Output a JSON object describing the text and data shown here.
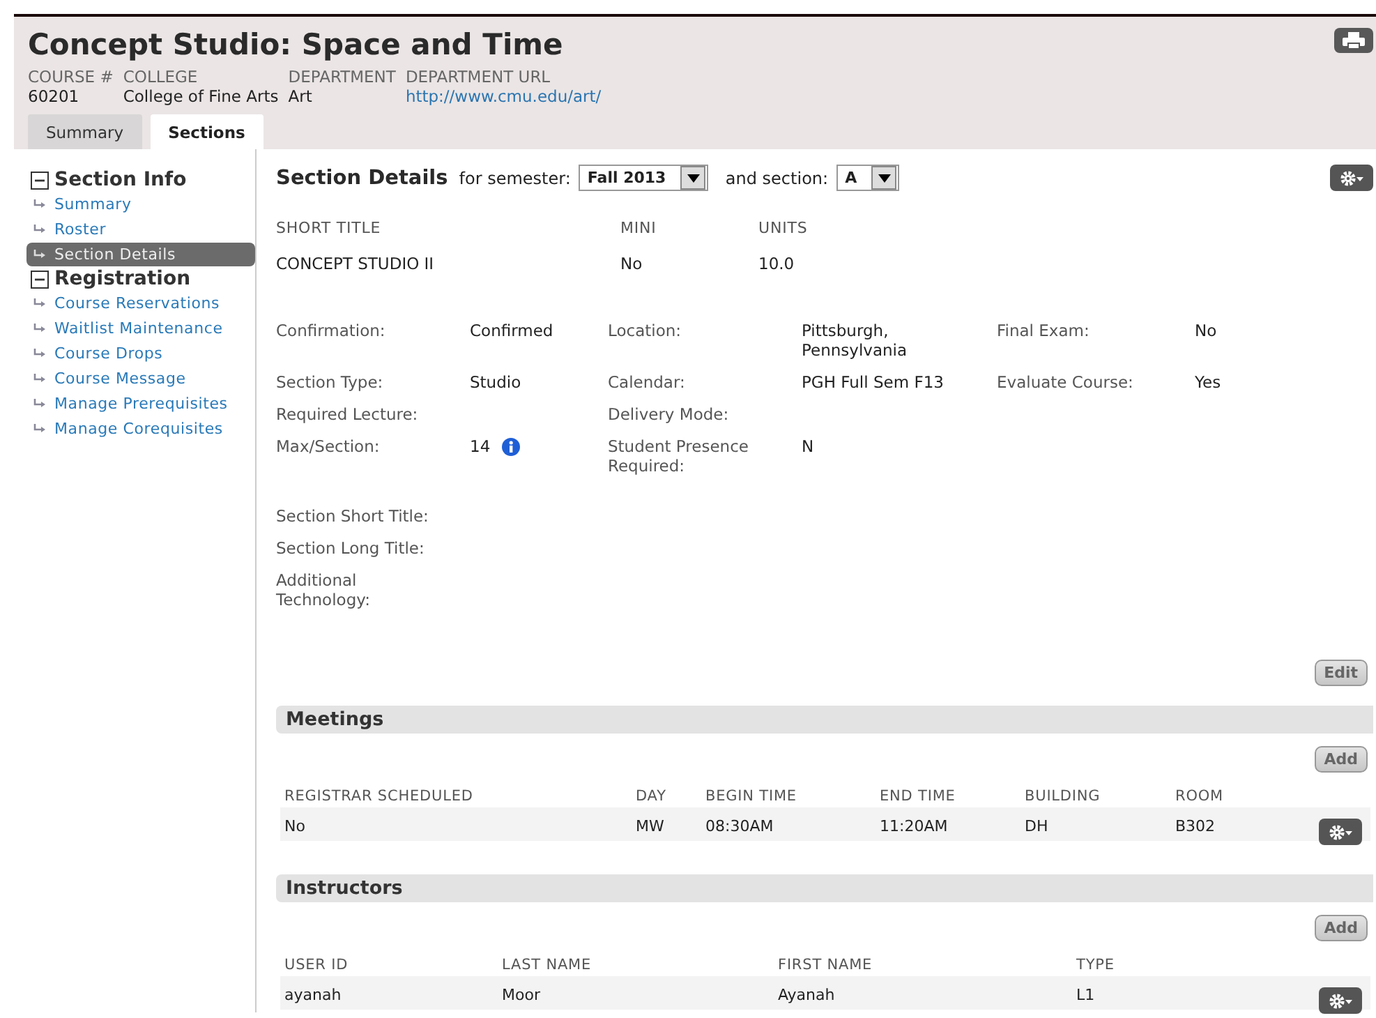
{
  "course": {
    "title": "Concept Studio: Space and Time",
    "fields": [
      {
        "label": "COURSE #",
        "value": "60201"
      },
      {
        "label": "COLLEGE",
        "value": "College of Fine Arts"
      },
      {
        "label": "DEPARTMENT",
        "value": "Art"
      },
      {
        "label": "DEPARTMENT URL",
        "value": "http://www.cmu.edu/art/",
        "kind": "link"
      }
    ]
  },
  "tabs": [
    {
      "label": "Summary",
      "selected": false
    },
    {
      "label": "Sections",
      "selected": true
    }
  ],
  "sidebar": {
    "groups": [
      {
        "title": "Section Info",
        "expanded": true,
        "items": [
          {
            "label": "Summary",
            "selected": false
          },
          {
            "label": "Roster",
            "selected": false
          },
          {
            "label": "Section Details",
            "selected": true
          }
        ]
      },
      {
        "title": "Registration",
        "expanded": true,
        "items": [
          {
            "label": "Course Reservations",
            "selected": false
          },
          {
            "label": "Waitlist Maintenance",
            "selected": false
          },
          {
            "label": "Course Drops",
            "selected": false
          },
          {
            "label": "Course Message",
            "selected": false
          },
          {
            "label": "Manage Prerequisites",
            "selected": false
          },
          {
            "label": "Manage Corequisites",
            "selected": false
          }
        ]
      }
    ]
  },
  "section_details": {
    "title": "Section Details",
    "semester_label": "for semester:",
    "semester": "Fall 2013",
    "section_label": "and section:",
    "section": "A",
    "summary": {
      "columns": [
        "SHORT TITLE",
        "MINI",
        "UNITS"
      ],
      "values": [
        "CONCEPT STUDIO II",
        "No",
        "10.0"
      ]
    },
    "rows": [
      [
        {
          "label": "Confirmation:",
          "value": "Confirmed"
        },
        {
          "label": "Location:",
          "value": "Pittsburgh, Pennsylvania"
        },
        {
          "label": "Final Exam:",
          "value": "No"
        }
      ],
      [
        {
          "label": "Section Type:",
          "value": "Studio"
        },
        {
          "label": "Calendar:",
          "value": "PGH Full Sem F13"
        },
        {
          "label": "Evaluate Course:",
          "value": "Yes"
        }
      ],
      [
        {
          "label": "Required Lecture:"
        },
        {
          "label": "Delivery Mode:"
        }
      ],
      [
        {
          "label": "Max/Section:",
          "value": "14",
          "info": true
        },
        {
          "label": "Student Presence Required:",
          "value": "N"
        }
      ]
    ],
    "extra": [
      {
        "label": "Section Short Title:"
      },
      {
        "label": "Section Long Title:"
      },
      {
        "label": "Additional Technology:"
      }
    ],
    "edit_button": "Edit"
  },
  "meetings": {
    "title": "Meetings",
    "add_button": "Add",
    "columns": [
      "REGISTRAR SCHEDULED",
      "DAY",
      "BEGIN TIME",
      "END TIME",
      "BUILDING",
      "ROOM"
    ],
    "rows": [
      [
        "No",
        "MW",
        "08:30AM",
        "11:20AM",
        "DH",
        "B302"
      ]
    ]
  },
  "instructors": {
    "title": "Instructors",
    "add_button": "Add",
    "columns": [
      "USER ID",
      "LAST NAME",
      "FIRST NAME",
      "TYPE"
    ],
    "rows": [
      [
        "ayanah",
        "Moor",
        "Ayanah",
        "L1"
      ]
    ]
  }
}
